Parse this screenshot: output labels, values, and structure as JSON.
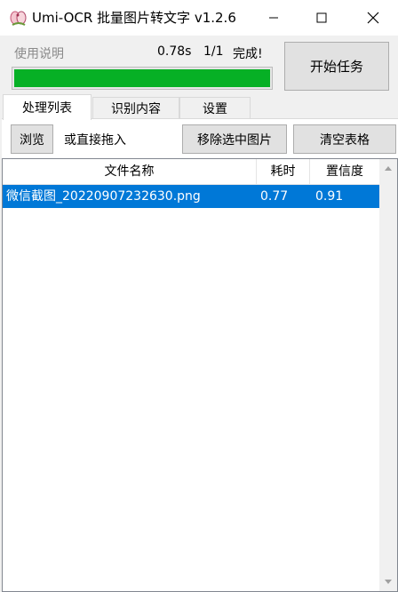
{
  "window": {
    "title": "Umi-OCR 批量图片转文字 v1.2.6"
  },
  "status": {
    "usage_link": "使用说明",
    "time": "0.78s",
    "count": "1/1",
    "done": "完成!",
    "progress_percent": 100
  },
  "buttons": {
    "start": "开始任务",
    "browse": "浏览",
    "drag_hint": "或直接拖入",
    "remove_selected": "移除选中图片",
    "clear_table": "清空表格"
  },
  "tabs": [
    {
      "label": "处理列表",
      "active": true
    },
    {
      "label": "识别内容",
      "active": false
    },
    {
      "label": "设置",
      "active": false
    }
  ],
  "table": {
    "columns": [
      "文件名称",
      "耗时",
      "置信度"
    ],
    "rows": [
      {
        "name": "微信截图_20220907232630.png",
        "time": "0.77",
        "confidence": "0.91",
        "selected": true
      }
    ]
  },
  "colors": {
    "progress": "#06b025",
    "selection": "#0078d7"
  },
  "icons": {
    "app": "umi-ocr-app-icon",
    "minimize": "minimize-icon",
    "maximize": "maximize-icon",
    "close": "close-icon",
    "scroll_up": "scroll-up-arrow-icon",
    "scroll_down": "scroll-down-arrow-icon"
  }
}
